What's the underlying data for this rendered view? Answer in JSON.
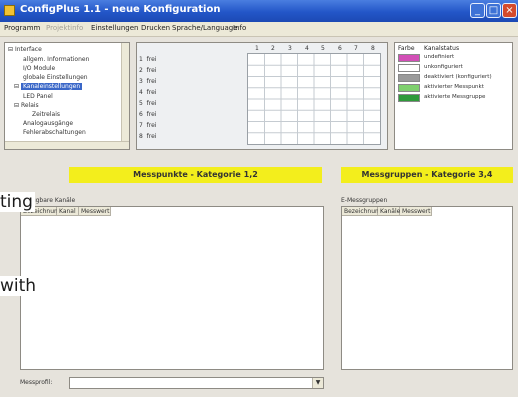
{
  "window": {
    "title": "ConfigPlus 1.1 - neue Konfiguration"
  },
  "menu": [
    {
      "label": "Programm",
      "disabled": false
    },
    {
      "label": "Projektinfo",
      "disabled": true
    },
    {
      "label": "Einstellungen",
      "disabled": false
    },
    {
      "label": "Drucken",
      "disabled": false
    },
    {
      "label": "Sprache/Language",
      "disabled": false
    },
    {
      "label": "Info",
      "disabled": false
    }
  ],
  "tree": {
    "items": [
      {
        "label": "Interface",
        "indent": 0
      },
      {
        "label": "allgem. Informationen",
        "indent": 2
      },
      {
        "label": "I/O Module",
        "indent": 2
      },
      {
        "label": "globale Einstellungen",
        "indent": 2
      },
      {
        "label": "Kanaleinstellungen",
        "indent": 1,
        "selected": true
      },
      {
        "label": "LED Panel",
        "indent": 2
      },
      {
        "label": "Relais",
        "indent": 1
      },
      {
        "label": "Zeitrelais",
        "indent": 3
      },
      {
        "label": "Analogausgänge",
        "indent": 2
      },
      {
        "label": "Fehlerabschaltungen",
        "indent": 2
      }
    ]
  },
  "grid": {
    "rows": [
      {
        "num": "1",
        "name": "frei"
      },
      {
        "num": "2",
        "name": "frei"
      },
      {
        "num": "3",
        "name": "frei"
      },
      {
        "num": "4",
        "name": "frei"
      },
      {
        "num": "5",
        "name": "frei"
      },
      {
        "num": "6",
        "name": "frei"
      },
      {
        "num": "7",
        "name": "frei"
      },
      {
        "num": "8",
        "name": "frei"
      }
    ],
    "columns": [
      "1",
      "2",
      "3",
      "4",
      "5",
      "6",
      "7",
      "8"
    ]
  },
  "legend": {
    "header_color": "Farbe",
    "header_status": "Kanalstatus",
    "items": [
      {
        "color": "#d24fb6",
        "label": "undefiniert"
      },
      {
        "color": "#ffffff",
        "label": "unkonfiguriert"
      },
      {
        "color": "#9a9a9a",
        "label": "deaktiviert (konfiguriert)"
      },
      {
        "color": "#7fd06e",
        "label": "aktivierter Messpunkt"
      },
      {
        "color": "#2f9a3a",
        "label": "aktivierte Messgruppe"
      }
    ]
  },
  "left_section": {
    "banner": "Messpunkte - Kategorie 1,2",
    "label": "verfügbare Kanäle",
    "columns": [
      "Bezeichnung",
      "Kanal",
      "Messwert"
    ]
  },
  "right_section": {
    "banner": "Messgruppen - Kategorie 3,4",
    "label": "E-Messgruppen",
    "columns": [
      "Bezeichnung",
      "Kanäle",
      "Messwert"
    ]
  },
  "footer": {
    "label": "Messprofil:",
    "value": ""
  },
  "overlay_text": [
    "ting",
    "with"
  ]
}
